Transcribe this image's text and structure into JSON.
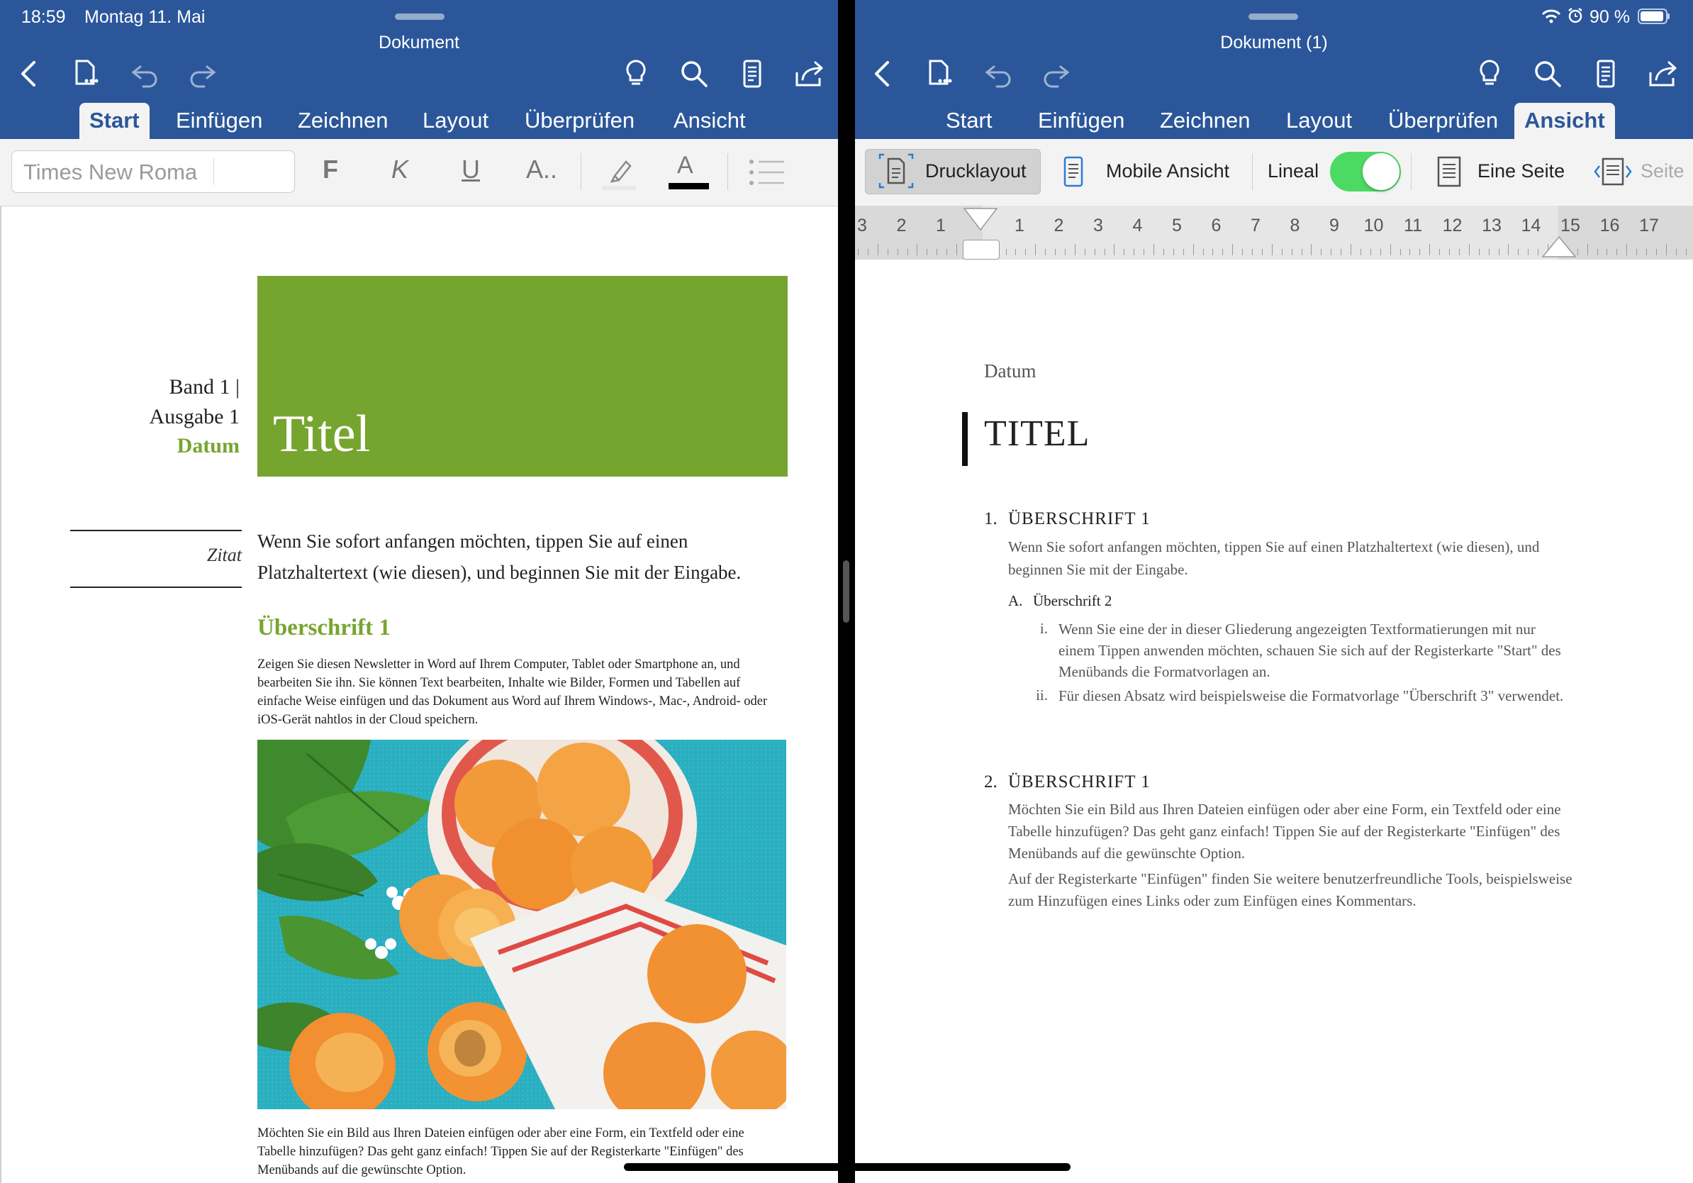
{
  "status": {
    "time": "18:59",
    "date": "Montag 11. Mai",
    "battery": "90 %"
  },
  "left": {
    "doc_title": "Dokument",
    "tabs": [
      "Start",
      "Einfügen",
      "Zeichnen",
      "Layout",
      "Überprüfen",
      "Ansicht"
    ],
    "active_tab": "Start",
    "font_name": "Times New Roma",
    "format_buttons": {
      "bold": "F",
      "italic": "K",
      "underline": "U",
      "font_more": "A..",
      "font_color": "A"
    },
    "doc": {
      "band": "Band 1 |",
      "ausgabe": "Ausgabe 1",
      "datum": "Datum",
      "title": "Titel",
      "zitat": "Zitat",
      "intro": "Wenn Sie sofort anfangen möchten, tippen Sie auf einen Platzhaltertext (wie diesen), und beginnen Sie mit der Eingabe.",
      "heading1": "Überschrift 1",
      "para1": "Zeigen Sie diesen Newsletter in Word auf Ihrem Computer, Tablet oder Smartphone an, und bearbeiten Sie ihn. Sie können Text bearbeiten, Inhalte wie Bilder, Formen und Tabellen auf einfache Weise einfügen und das Dokument aus Word auf Ihrem Windows-, Mac-, Android- oder iOS-Gerät nahtlos in der Cloud speichern.",
      "para2": "Möchten Sie ein Bild aus Ihren Dateien einfügen oder aber eine Form, ein Textfeld oder eine Tabelle hinzufügen? Das geht ganz einfach! Tippen Sie auf der Registerkarte \"Einfügen\" des Menübands auf die gewünschte Option."
    }
  },
  "right": {
    "doc_title": "Dokument (1)",
    "tabs": [
      "Start",
      "Einfügen",
      "Zeichnen",
      "Layout",
      "Überprüfen",
      "Ansicht"
    ],
    "active_tab": "Ansicht",
    "view_buttons": {
      "print_layout": "Drucklayout",
      "mobile_view": "Mobile Ansicht",
      "ruler": "Lineal",
      "one_page": "Eine Seite",
      "page_width": "Seite"
    },
    "ruler_on": true,
    "ruler_numbers": [
      "3",
      "2",
      "1",
      "1",
      "2",
      "3",
      "4",
      "5",
      "6",
      "7",
      "8",
      "9",
      "10",
      "11",
      "12",
      "13",
      "14",
      "15",
      "16",
      "17"
    ],
    "doc": {
      "datum": "Datum",
      "title": "TITEL",
      "h1_num": "1.",
      "h1": "ÜBERSCHRIFT 1",
      "h1_text": "Wenn Sie sofort anfangen möchten, tippen Sie auf einen Platzhaltertext (wie diesen), und beginnen Sie mit der Eingabe.",
      "h2_num": "A.",
      "h2": "Überschrift 2",
      "item1_num": "i.",
      "item1": "Wenn Sie eine der in dieser Gliederung angezeigten Textformatierungen mit nur einem Tippen anwenden möchten, schauen Sie sich auf der Registerkarte \"Start\" des Menübands die Formatvorlagen an.",
      "item2_num": "ii.",
      "item2": "Für diesen Absatz wird beispielsweise die Formatvorlage \"Überschrift 3\" verwendet.",
      "h1b_num": "2.",
      "h1b": "ÜBERSCHRIFT 1",
      "h1b_text1": "Möchten Sie ein Bild aus Ihren Dateien einfügen oder aber eine Form, ein Textfeld oder eine Tabelle hinzufügen? Das geht ganz einfach! Tippen Sie auf der Registerkarte \"Einfügen\" des Menübands auf die gewünschte Option.",
      "h1b_text2": "Auf der Registerkarte \"Einfügen\" finden Sie weitere benutzerfreundliche Tools, beispielsweise zum Hinzufügen eines Links oder zum Einfügen eines Kommentars."
    }
  },
  "colors": {
    "word_blue": "#2b579a",
    "newsletter_green": "#76a52f",
    "toggle_green": "#4cd964"
  }
}
